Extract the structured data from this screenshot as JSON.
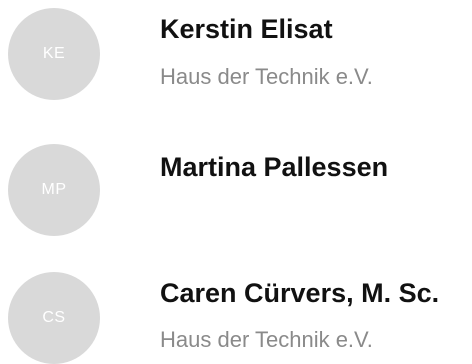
{
  "contacts": [
    {
      "initials": "KE",
      "name": "Kerstin Elisat",
      "organization": "Haus der Technik e.V."
    },
    {
      "initials": "MP",
      "name": "Martina Pallessen",
      "organization": ""
    },
    {
      "initials": "CS",
      "name": "Caren Cürvers, M. Sc.",
      "organization": "Haus der Technik e.V."
    }
  ],
  "colors": {
    "avatar_background": "#d9d9d9",
    "avatar_text": "#ffffff",
    "name_text": "#111111",
    "organization_text": "#8a8a8a"
  }
}
